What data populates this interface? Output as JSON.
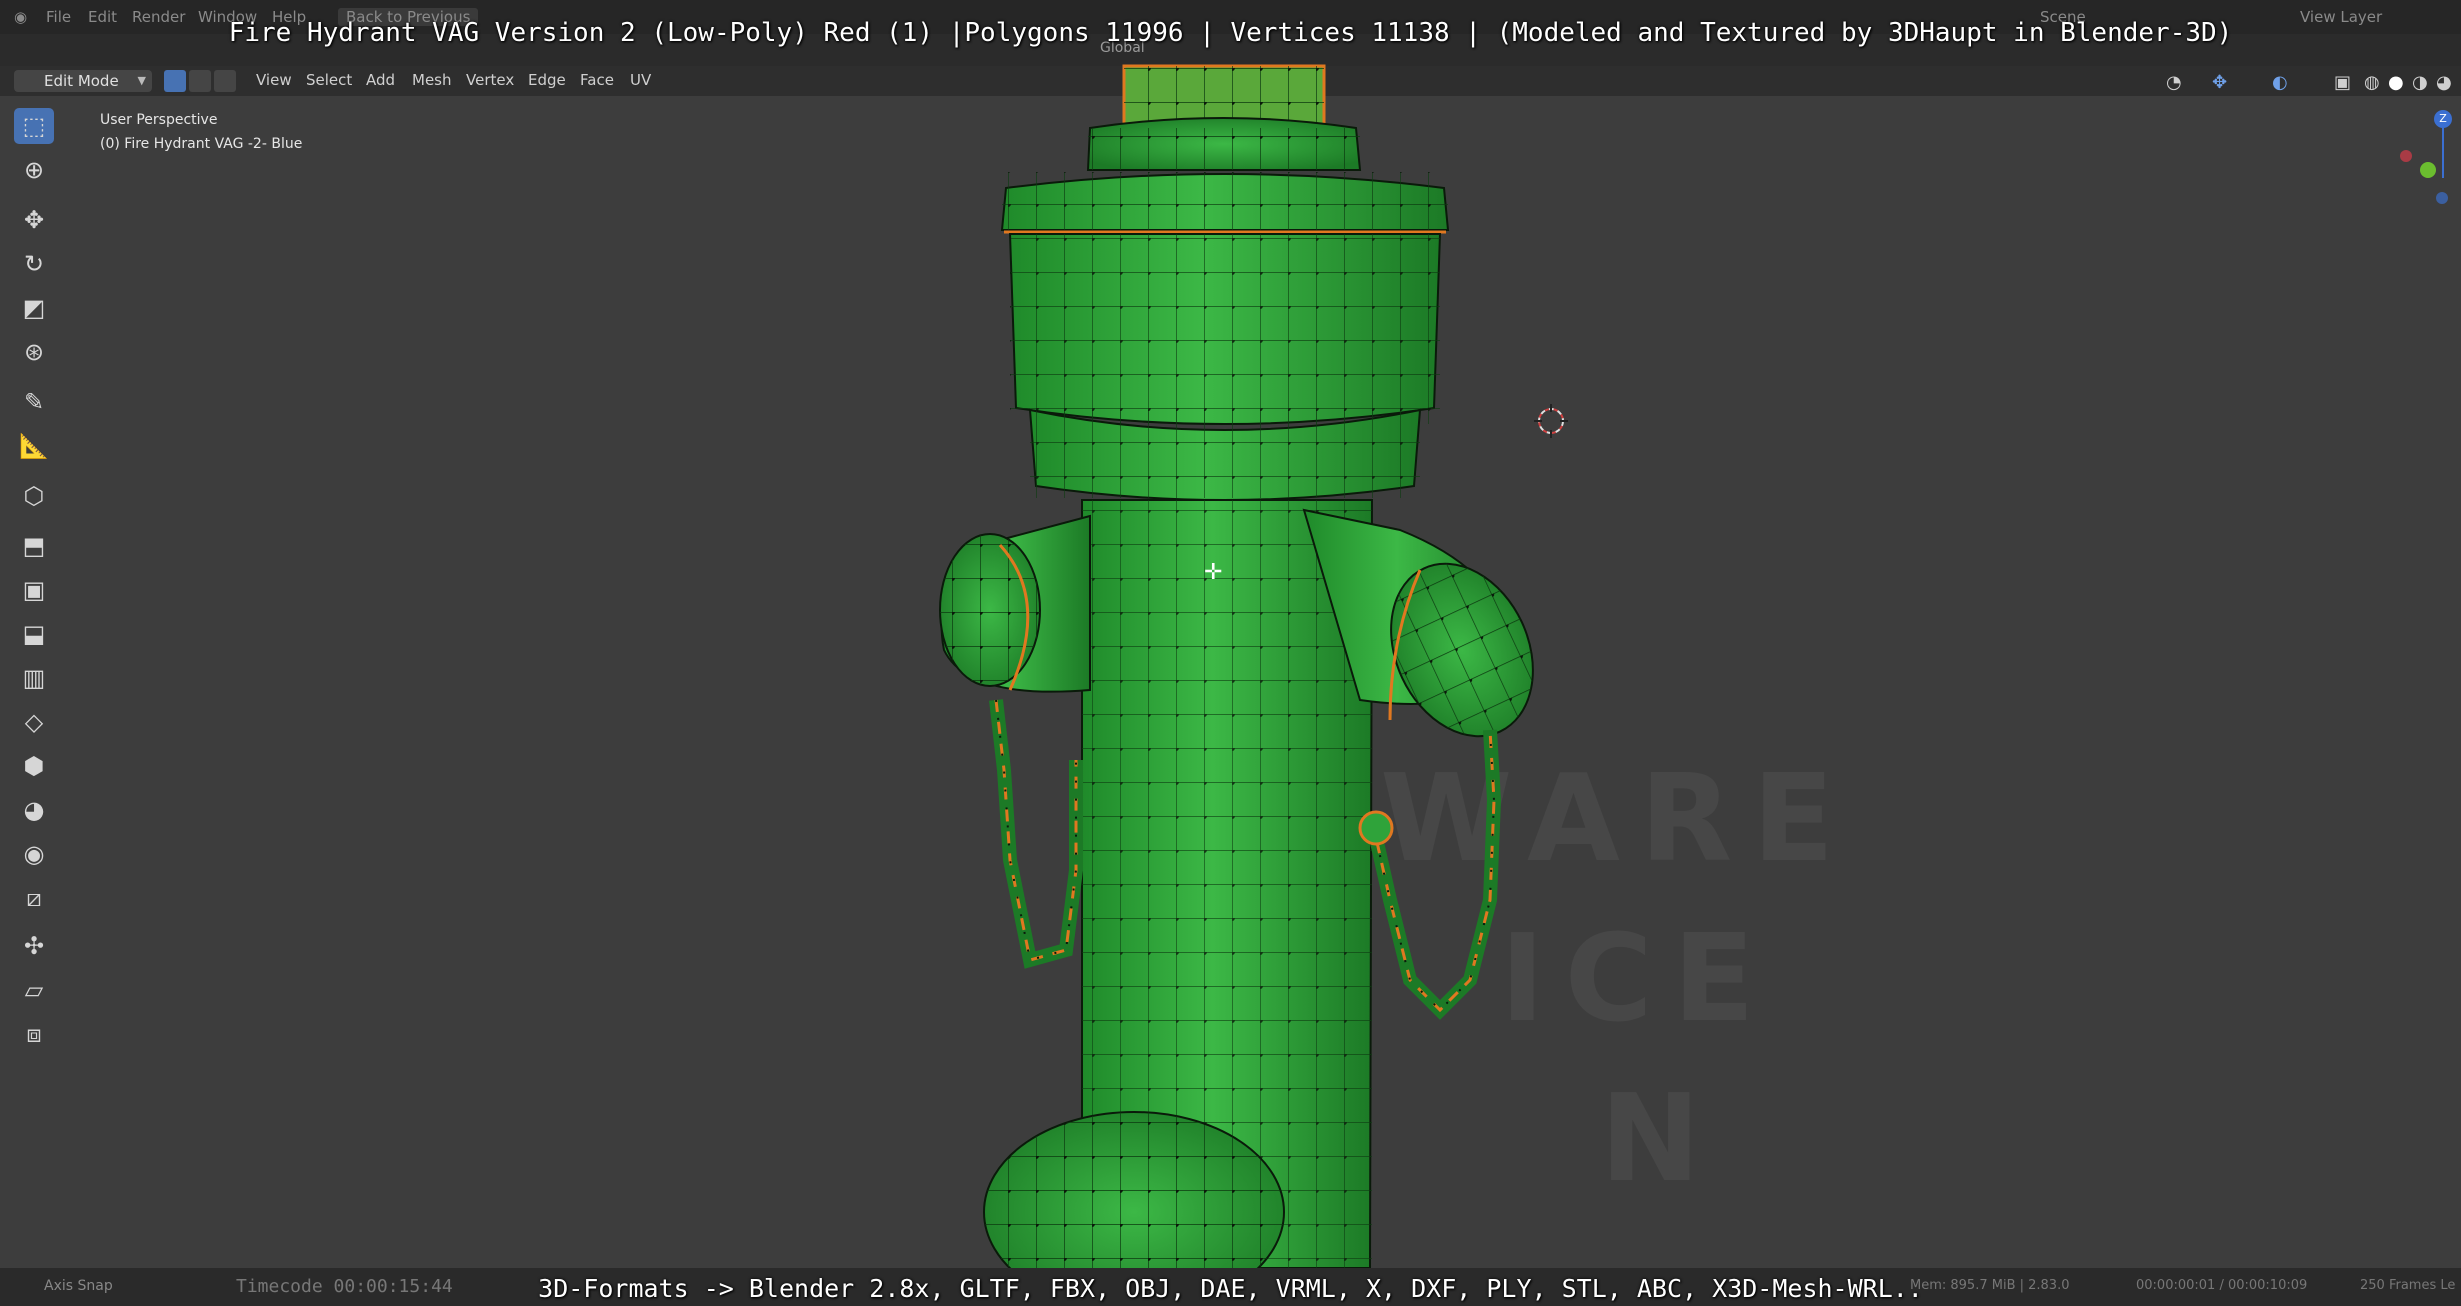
{
  "window": {
    "title_overlay": "Fire Hydrant VAG Version 2 (Low-Poly) Red (1) |Polygons 11996 | Vertices 11138 | (Modeled and Textured by 3DHaupt in Blender-3D)",
    "bottom_overlay": "3D-Formats -> Blender 2.8x, GLTF, FBX, OBJ, DAE, VRML, X, DXF, PLY, STL, ABC, X3D-Mesh-WRL..",
    "top_menu": [
      "File",
      "Edit",
      "Render",
      "Window",
      "Help"
    ],
    "back_to_previous": "Back to Previous",
    "scene_label": "Scene",
    "view_layer_label": "View Layer"
  },
  "header": {
    "mode": "Edit Mode",
    "menus": [
      "View",
      "Select",
      "Add",
      "Mesh",
      "Vertex",
      "Edge",
      "Face",
      "UV"
    ],
    "transform_orientation": "Global"
  },
  "viewport": {
    "perspective": "User Perspective",
    "object_name": "(0) Fire Hydrant VAG -2- Blue",
    "watermark_lines": [
      "WARE",
      "ICE",
      "N"
    ]
  },
  "toolbar": {
    "tools": [
      "select-box-icon",
      "cursor-icon",
      "move-icon",
      "rotate-icon",
      "scale-icon",
      "transform-icon",
      "annotate-icon",
      "measure-icon",
      "add-cube-icon",
      "extrude-icon",
      "inset-icon",
      "bevel-icon",
      "loop-cut-icon",
      "knife-icon",
      "poly-build-icon",
      "spin-icon",
      "smooth-icon",
      "edge-slide-icon",
      "shrink-fatten-icon",
      "shear-icon",
      "rip-icon"
    ]
  },
  "status": {
    "axis_snap": "Axis Snap",
    "timecode": "Timecode 00:00:15:44",
    "memory": "Mem: 895.7 MiB | 2.83.0",
    "frame_time": "00:00:00:01 / 00:00:10:09",
    "frames": "250 Frames Le"
  },
  "colors": {
    "mesh_green": "#2fa33a",
    "edge_orange": "#e07820",
    "accent_blue": "#4772b3"
  }
}
